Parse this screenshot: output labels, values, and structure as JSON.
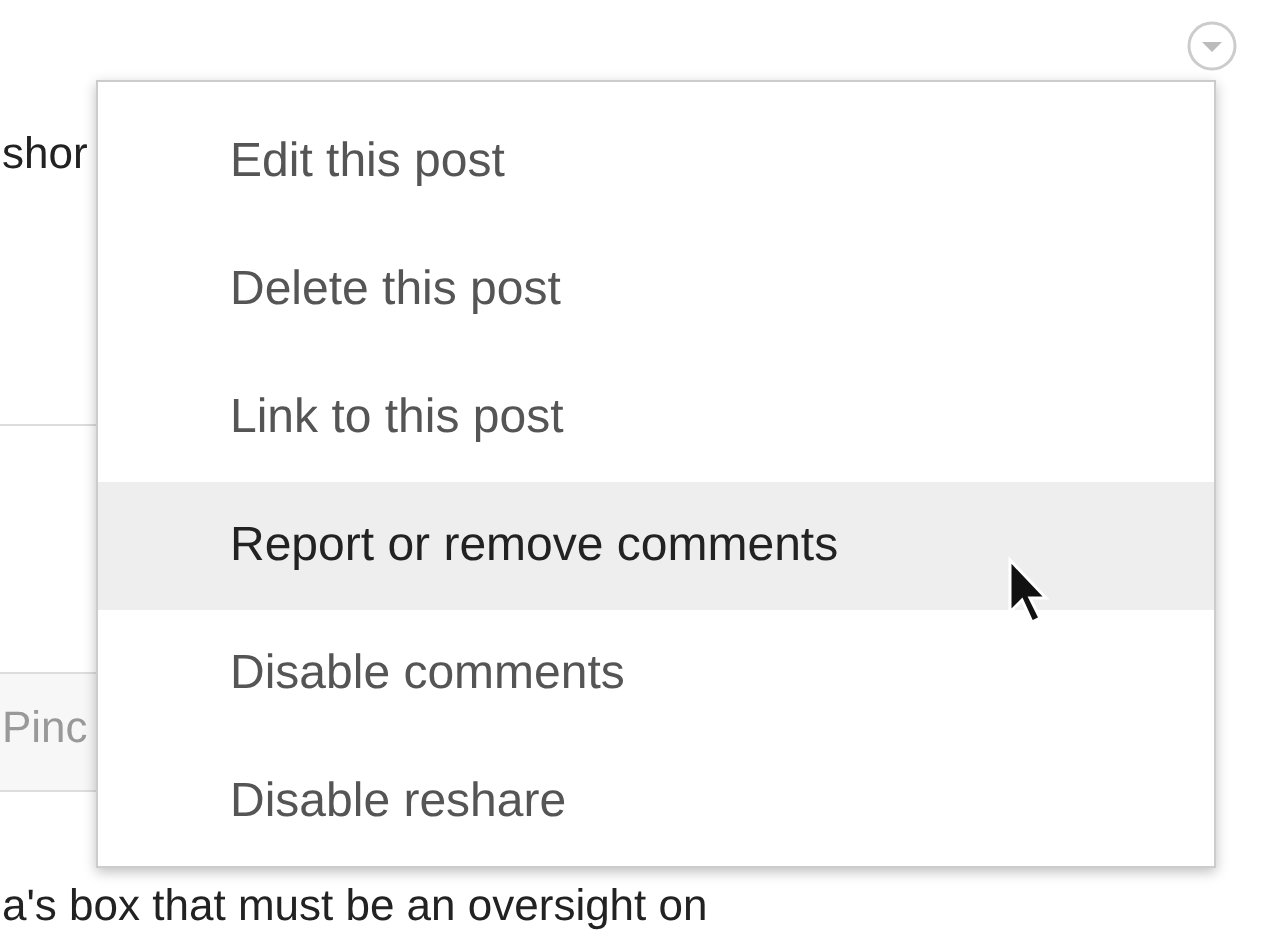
{
  "post": {
    "text_fragment": "shor",
    "field_fragment": "Pinc",
    "body_fragment": "a's box that must be an oversight on"
  },
  "menu": {
    "items": [
      {
        "label": "Edit this post",
        "highlighted": false
      },
      {
        "label": "Delete this post",
        "highlighted": false
      },
      {
        "label": "Link to this post",
        "highlighted": false
      },
      {
        "label": "Report or remove comments",
        "highlighted": true
      },
      {
        "label": "Disable comments",
        "highlighted": false
      },
      {
        "label": "Disable reshare",
        "highlighted": false
      }
    ]
  }
}
